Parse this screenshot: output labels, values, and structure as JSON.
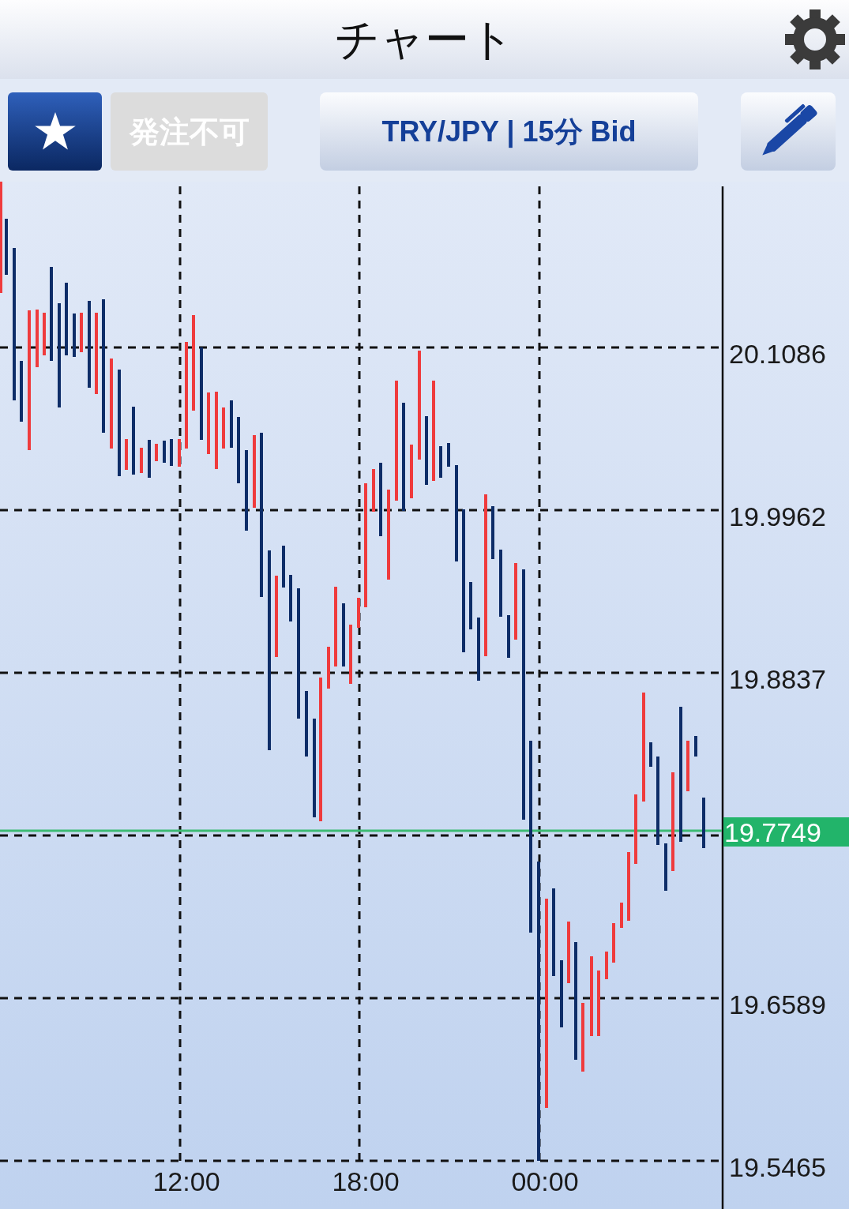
{
  "header": {
    "title": "チャート"
  },
  "toolbar": {
    "order_button": {
      "label": "発注不可",
      "disabled": true
    },
    "symbol_button": {
      "label": "TRY/JPY | 15分 Bid"
    }
  },
  "chart": {
    "price_labels": [
      "20.1086",
      "19.9962",
      "19.8837",
      "19.6589",
      "19.5465"
    ],
    "time_labels": [
      "12:00",
      "18:00",
      "00:00"
    ],
    "current_price": "19.7749"
  }
}
